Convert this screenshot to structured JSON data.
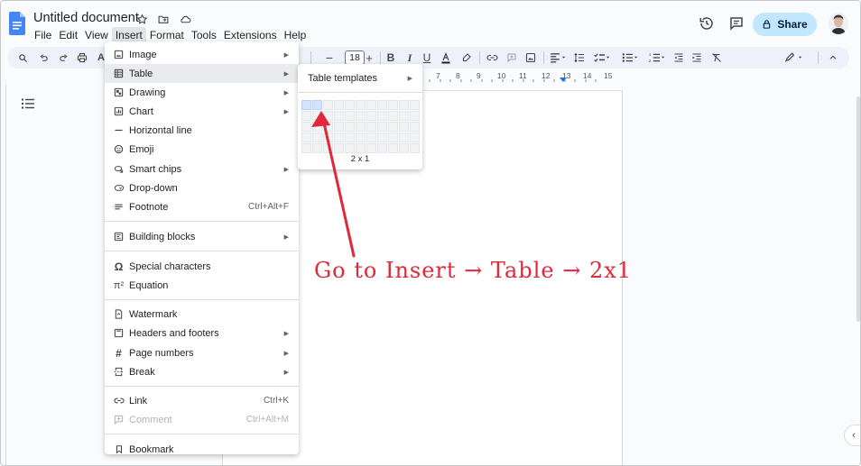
{
  "doc": {
    "title": "Untitled document"
  },
  "menubar": {
    "items": [
      "File",
      "Edit",
      "View",
      "Insert",
      "Format",
      "Tools",
      "Extensions",
      "Help"
    ],
    "active": "Insert"
  },
  "header": {
    "share_label": "Share"
  },
  "toolbar": {
    "font_size": "18",
    "zoom_hint": "A"
  },
  "ruler": {
    "labels": [
      "7",
      "8",
      "9",
      "10",
      "11",
      "12",
      "13",
      "14",
      "15"
    ]
  },
  "insert_menu": {
    "items": [
      {
        "label": "Image",
        "icon": "image-icon",
        "submenu": true
      },
      {
        "label": "Table",
        "icon": "table-icon",
        "submenu": true,
        "highlighted": true
      },
      {
        "label": "Drawing",
        "icon": "drawing-icon",
        "submenu": true
      },
      {
        "label": "Chart",
        "icon": "chart-icon",
        "submenu": true
      },
      {
        "label": "Horizontal line",
        "icon": "horizontal-line-icon"
      },
      {
        "label": "Emoji",
        "icon": "emoji-icon"
      },
      {
        "label": "Smart chips",
        "icon": "smart-chips-icon",
        "submenu": true
      },
      {
        "label": "Drop-down",
        "icon": "dropdown-icon"
      },
      {
        "label": "Footnote",
        "icon": "footnote-icon",
        "shortcut": "Ctrl+Alt+F"
      },
      {
        "label": "Building blocks",
        "icon": "building-blocks-icon",
        "submenu": true
      },
      {
        "label": "Special characters",
        "icon": "omega-icon"
      },
      {
        "label": "Equation",
        "icon": "equation-icon"
      },
      {
        "label": "Watermark",
        "icon": "watermark-icon"
      },
      {
        "label": "Headers and footers",
        "icon": "headers-footers-icon",
        "submenu": true
      },
      {
        "label": "Page numbers",
        "icon": "hash-icon",
        "submenu": true
      },
      {
        "label": "Break",
        "icon": "break-icon",
        "submenu": true
      },
      {
        "label": "Link",
        "icon": "link-icon",
        "shortcut": "Ctrl+K"
      },
      {
        "label": "Comment",
        "icon": "comment-add-icon",
        "shortcut": "Ctrl+Alt+M",
        "disabled": true
      },
      {
        "label": "Bookmark",
        "icon": "bookmark-icon"
      }
    ]
  },
  "table_submenu": {
    "templates_label": "Table templates",
    "grid_cols": 11,
    "grid_rows": 5,
    "selected_cols": 2,
    "selected_rows": 1,
    "size_label": "2 x 1"
  },
  "annotation": {
    "text": "Go to Insert → Table → 2x1",
    "color": "#e0283a"
  },
  "colors": {
    "share_bg": "#c2e7ff",
    "accent_blue": "#1a73e8",
    "grid_selected": "#d3e3fd"
  }
}
